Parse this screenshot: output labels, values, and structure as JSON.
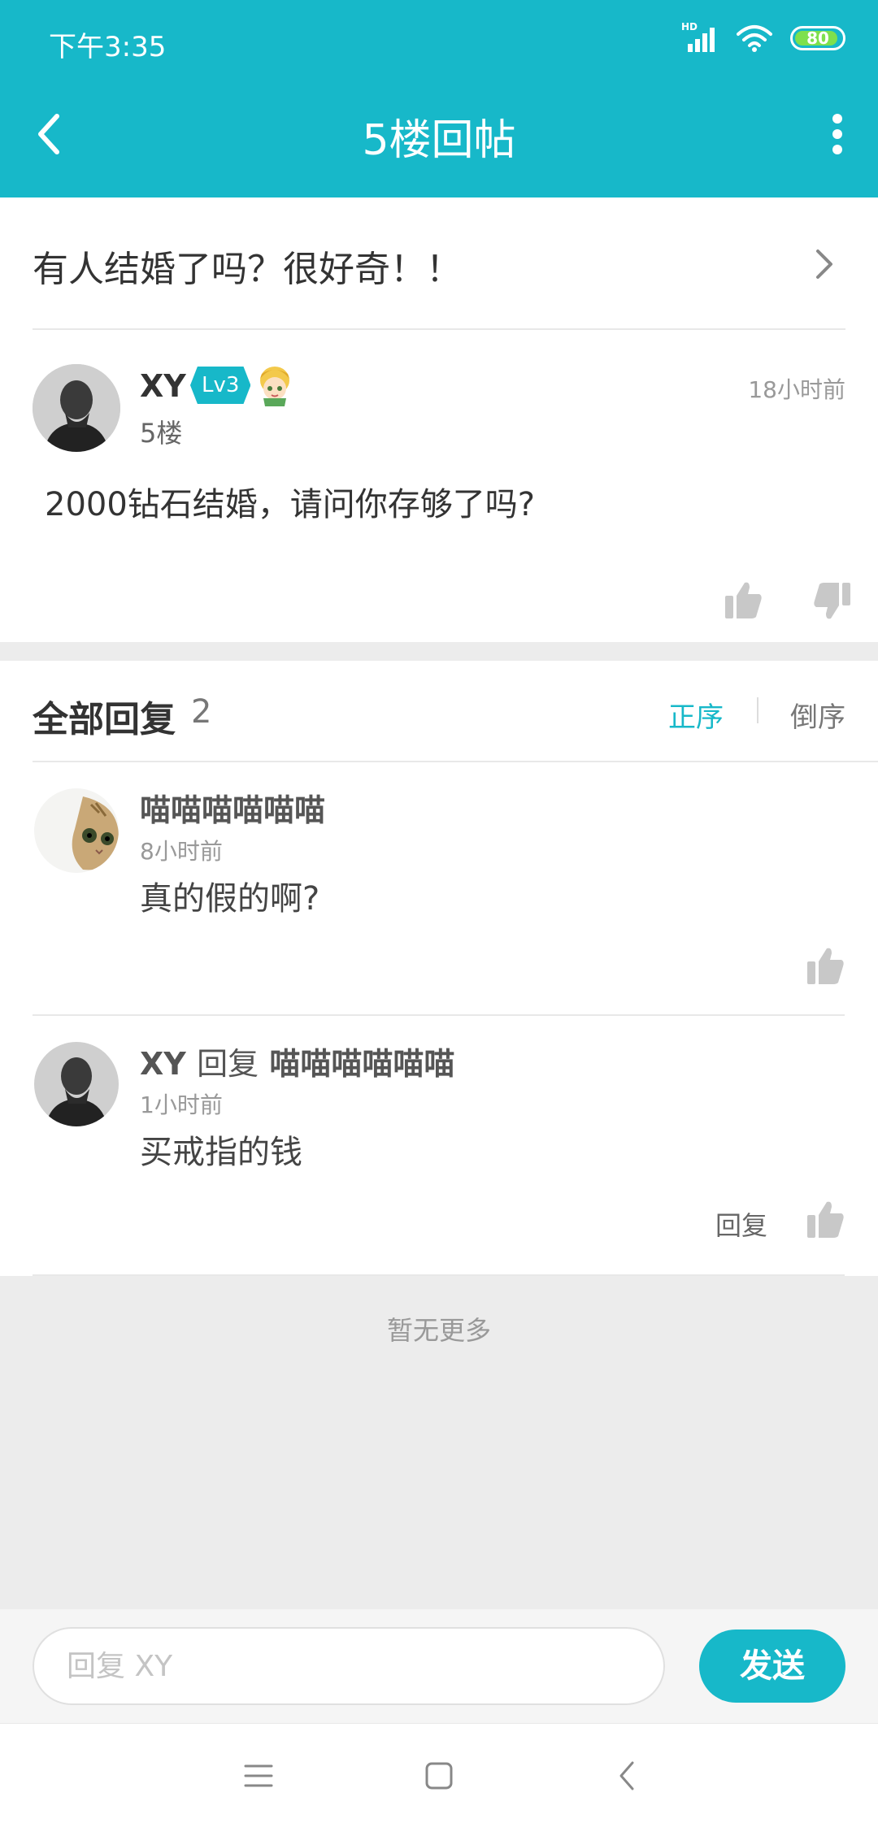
{
  "status_bar": {
    "time": "下午3:35",
    "network": "HD",
    "battery": "80"
  },
  "nav": {
    "title": "5楼回帖"
  },
  "thread": {
    "title": "有人结婚了吗？很好奇！！"
  },
  "post": {
    "user": "XY",
    "level": "Lv3",
    "floor": "5楼",
    "time": "18小时前",
    "body": "2000钻石结婚，请问你存够了吗?"
  },
  "replies": {
    "title": "全部回复",
    "count": "2",
    "sort_asc": "正序",
    "sort_desc": "倒序",
    "items": [
      {
        "user": "喵喵喵喵喵喵",
        "time": "8小时前",
        "body": "真的假的啊?"
      },
      {
        "user": "XY",
        "reply_word": "回复",
        "target": "喵喵喵喵喵喵",
        "time": "1小时前",
        "body": "买戒指的钱",
        "reply_action": "回复"
      }
    ]
  },
  "no_more": "暂无更多",
  "input": {
    "placeholder": "回复 XY",
    "send": "发送"
  },
  "colors": {
    "accent": "#17b8c9",
    "battery": "#7ee04d"
  }
}
